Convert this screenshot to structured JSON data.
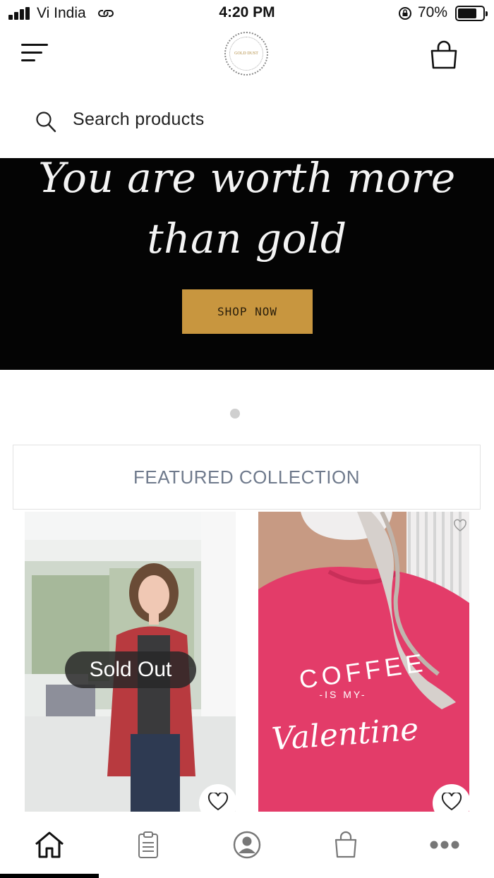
{
  "status_bar": {
    "carrier": "Vi India",
    "time": "4:20 PM",
    "battery": "70%",
    "battery_level": 0.7
  },
  "header": {
    "logo_text": "GOLD DUST",
    "icons": {
      "menu": "menu-icon",
      "cart": "shopping-bag-icon"
    }
  },
  "search": {
    "placeholder": "Search products"
  },
  "banner": {
    "line1": "You are worth more",
    "line2": "than gold",
    "cta": "SHOP NOW",
    "cta_color": "#c8963f",
    "background": "#040404",
    "slides_count": 1,
    "active_slide": 1
  },
  "featured": {
    "title": "FEATURED COLLECTION"
  },
  "products": [
    {
      "badge": "Sold Out",
      "image": "red-cardigan-photo",
      "sold_out": true
    },
    {
      "badge": "",
      "image": "pink-sweatshirt-photo",
      "sold_out": false,
      "shirt_text": [
        "COFFEE",
        "-IS MY-",
        "Valentine"
      ]
    }
  ],
  "bottom_nav": {
    "items": [
      "home-icon",
      "orders-icon",
      "account-icon",
      "cart-icon",
      "more-icon"
    ],
    "active": "home-icon"
  }
}
